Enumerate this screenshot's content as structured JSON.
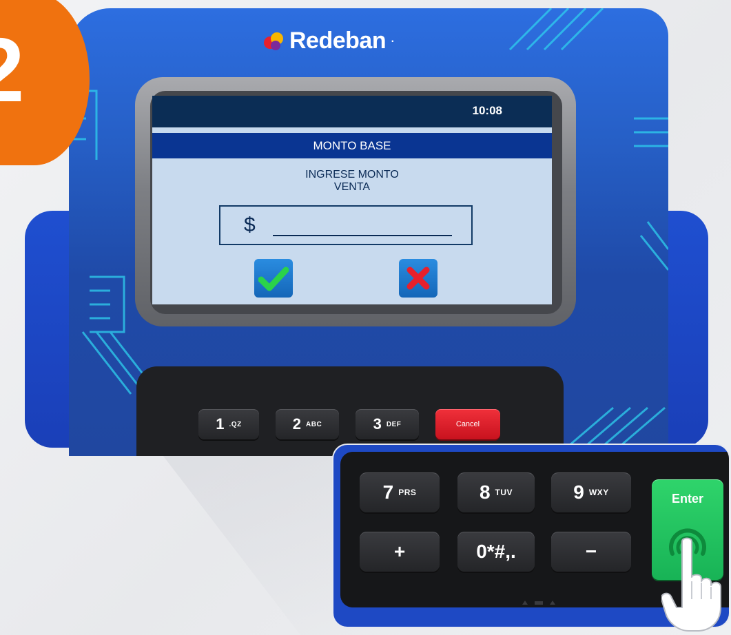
{
  "step": {
    "number": "2"
  },
  "brand": {
    "name": "Redeban",
    "mark": "·"
  },
  "screen": {
    "time": "10:08",
    "title": "MONTO BASE",
    "prompt_line1": "INGRESE MONTO",
    "prompt_line2": "VENTA",
    "currency_symbol": "$",
    "amount_value": ""
  },
  "keypad_top": {
    "keys": [
      {
        "num": "1",
        "sub": ".QZ"
      },
      {
        "num": "2",
        "sub": "ABC"
      },
      {
        "num": "3",
        "sub": "DEF"
      }
    ],
    "cancel_label": "Cancel"
  },
  "keypad_zoom": {
    "keys": [
      {
        "num": "7",
        "sub": "PRS"
      },
      {
        "num": "8",
        "sub": "TUV"
      },
      {
        "num": "9",
        "sub": "WXY"
      },
      {
        "num": "+",
        "sub": ""
      },
      {
        "num": "0*#,.",
        "sub": ""
      },
      {
        "num": "−",
        "sub": ""
      }
    ],
    "enter_label": "Enter"
  },
  "colors": {
    "badge": "#f0720f",
    "device_blue": "#2d6ee0",
    "screen_bg": "#c8daee",
    "title_bar": "#0a3592",
    "confirm_green": "#2bd24a",
    "cancel_red": "#e8202c",
    "enter_green": "#2fd46b"
  },
  "icons": [
    "confirm-check-icon",
    "cancel-x-icon",
    "pointing-hand-icon",
    "redeban-logo-icon"
  ]
}
